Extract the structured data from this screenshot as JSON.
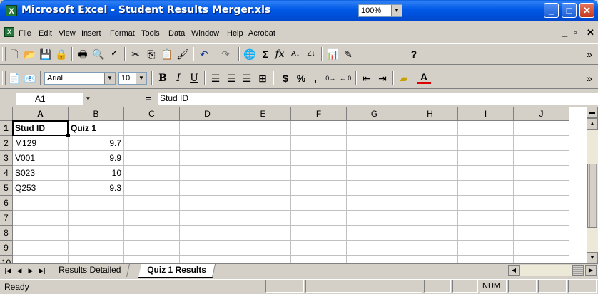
{
  "window": {
    "title": "Microsoft Excel - Student Results Merger.xls",
    "app_icon_glyph": "X",
    "minimize_glyph": "_",
    "maximize_glyph": "□",
    "close_glyph": "✕"
  },
  "menubar": {
    "items": [
      "File",
      "Edit",
      "View",
      "Insert",
      "Format",
      "Tools",
      "Data",
      "Window",
      "Help",
      "Acrobat"
    ],
    "mdi_controls": [
      "_",
      "▫",
      "✕"
    ]
  },
  "toolbar_standard": {
    "icons": [
      "new-icon",
      "open-icon",
      "save-icon",
      "permission-icon",
      "print-icon",
      "print-preview-icon",
      "spelling-icon",
      "cut-icon",
      "copy-icon",
      "paste-icon",
      "format-painter-icon",
      "undo-icon",
      "redo-icon",
      "hyperlink-icon",
      "autosum-icon",
      "function-icon",
      "sort-ascending-icon",
      "sort-descending-icon",
      "chart-wizard-icon",
      "drawing-icon",
      "help-icon"
    ],
    "zoom": "100%"
  },
  "toolbar_formatting": {
    "font_name": "Arial",
    "font_size": "10",
    "currency_label": "$",
    "percent_label": "%",
    "comma_label": ","
  },
  "formula_bar": {
    "name_box": "A1",
    "equals": "=",
    "content": "Stud ID"
  },
  "grid": {
    "columns": [
      "A",
      "B",
      "C",
      "D",
      "E",
      "F",
      "G",
      "H",
      "I",
      "J"
    ],
    "rows": [
      "1",
      "2",
      "3",
      "4",
      "5",
      "6",
      "7",
      "8",
      "9",
      "10"
    ],
    "cells": {
      "A1": "Stud ID",
      "B1": "Quiz 1",
      "A2": "M129",
      "B2": "9.7",
      "A3": "V001",
      "B3": "9.9",
      "A4": "S023",
      "B4": "10",
      "A5": "Q253",
      "B5": "9.3"
    },
    "active_cell": "A1"
  },
  "sheet_tabs": {
    "tabs": [
      "Results Detailed",
      "Quiz 1 Results"
    ],
    "active": "Quiz 1 Results"
  },
  "statusbar": {
    "status": "Ready",
    "num_indicator": "NUM"
  }
}
